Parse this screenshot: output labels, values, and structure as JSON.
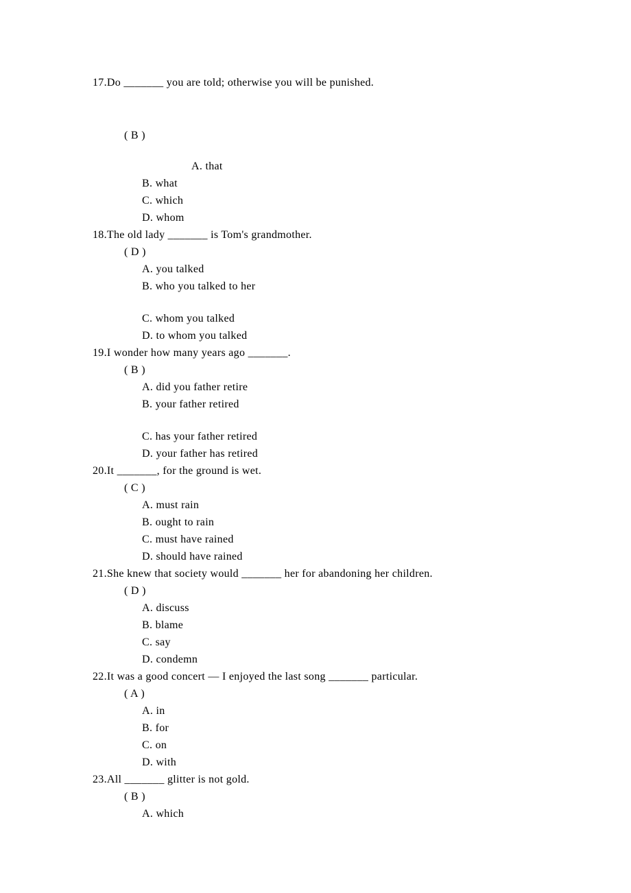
{
  "questions": [
    {
      "num": "17.",
      "text": "Do _______ you are told; otherwise you will be punished.",
      "answer": "( B )",
      "options": [
        "A.   that",
        "B. what",
        "C. which",
        "D. whom"
      ]
    },
    {
      "num": "18.",
      "text": "The old lady _______ is Tom's grandmother.",
      "answer": "( D )",
      "options": [
        "A. you talked",
        "B. who you talked to her",
        "C. whom you talked",
        "D. to whom you talked"
      ]
    },
    {
      "num": "19.",
      "text": "I wonder how many years ago _______.",
      "answer": "( B )",
      "options": [
        "A. did you father retire",
        "B. your father retired",
        "C. has your father retired",
        "D. your father has retired"
      ]
    },
    {
      "num": "20.",
      "text": "It _______, for the ground is wet.",
      "answer": "( C )",
      "options": [
        "A. must rain",
        "B. ought to rain",
        "C. must have rained",
        "D. should have rained"
      ]
    },
    {
      "num": "21.",
      "text": "She knew that society would _______ her for abandoning her children.",
      "answer": "( D )",
      "options": [
        "A. discuss",
        "B. blame",
        "C. say",
        "D. condemn"
      ]
    },
    {
      "num": "22.",
      "text": "It was a good concert — I enjoyed the last song _______ particular.",
      "answer": "( A )",
      "options": [
        "A. in",
        "B. for",
        "C. on",
        "D. with"
      ]
    },
    {
      "num": "23.",
      "text": "All _______ glitter is not gold.",
      "answer": "( B )",
      "options": [
        "A. which"
      ]
    }
  ]
}
